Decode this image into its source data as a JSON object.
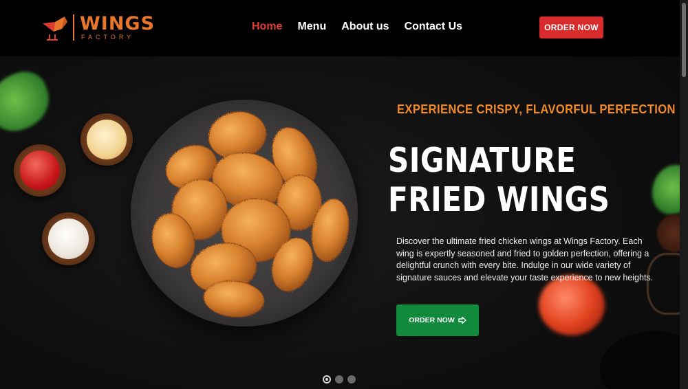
{
  "brand": {
    "name": "WINGS",
    "tagline": "FACTORY",
    "logo_icon": "origami-bird-icon"
  },
  "nav": {
    "items": [
      {
        "label": "Home",
        "active": true
      },
      {
        "label": "Menu",
        "active": false
      },
      {
        "label": "About us",
        "active": false
      },
      {
        "label": "Contact Us",
        "active": false
      }
    ]
  },
  "header": {
    "order_label": "ORDER NOW"
  },
  "hero": {
    "eyebrow": "EXPERIENCE CRISPY, FLAVORFUL PERFECTION",
    "title": "SIGNATURE FRIED WINGS",
    "description": "Discover the ultimate fried chicken wings at Wings Factory. Each wing is expertly seasoned and fried to golden perfection, offering a delightful crunch with every bite. Indulge in our wide variety of signature sauces and elevate your taste experience to new heights.",
    "cta_label": "ORDER NOW",
    "cta_icon": "arrow-right-icon"
  },
  "carousel": {
    "slide_count": 3,
    "active_index": 0
  },
  "colors": {
    "accent_orange": "#f08a2a",
    "nav_active": "#e23b33",
    "header_button": "#d92b2b",
    "cta_green": "#118a3c",
    "header_bg": "#000000"
  }
}
